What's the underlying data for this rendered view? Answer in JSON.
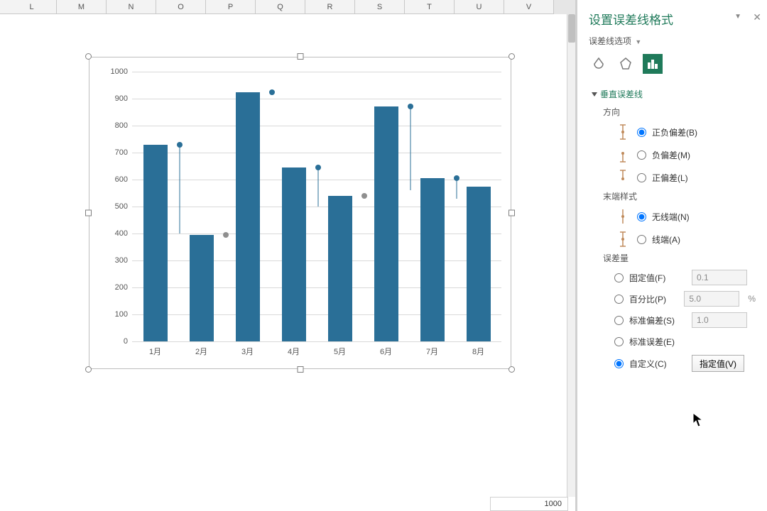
{
  "columns": [
    "L",
    "M",
    "N",
    "O",
    "P",
    "Q",
    "R",
    "S",
    "T",
    "U",
    "V"
  ],
  "pane": {
    "title": "设置误差线格式",
    "options_label": "误差线选项",
    "section_title": "垂直误差线",
    "direction_label": "方向",
    "dir_both": "正负偏差(B)",
    "dir_minus": "负偏差(M)",
    "dir_plus": "正偏差(L)",
    "endstyle_label": "末端样式",
    "end_none": "无线端(N)",
    "end_cap": "线端(A)",
    "error_amount_label": "误差量",
    "ea_fixed": "固定值(F)",
    "ea_percent": "百分比(P)",
    "ea_stddev": "标准偏差(S)",
    "ea_stderr": "标准误差(E)",
    "ea_custom": "自定义(C)",
    "ea_fixed_val": "0.1",
    "ea_percent_val": "5.0",
    "ea_stddev_val": "1.0",
    "specify_btn": "指定值(V)"
  },
  "bottom_cell_value": "1000",
  "chart_data": {
    "type": "bar",
    "categories": [
      "1月",
      "2月",
      "3月",
      "4月",
      "5月",
      "6月",
      "7月",
      "8月"
    ],
    "values": [
      730,
      395,
      925,
      645,
      540,
      870,
      605,
      575
    ],
    "error_plus": [
      0,
      0,
      0,
      0,
      0,
      0,
      0,
      0
    ],
    "error_markers": [
      {
        "x": 1,
        "y": 730,
        "color": "blue"
      },
      {
        "x": 2,
        "y": 395,
        "color": "grey"
      },
      {
        "x": 3,
        "y": 925,
        "color": "blue"
      },
      {
        "x": 4,
        "y": 645,
        "color": "blue"
      },
      {
        "x": 5,
        "y": 540,
        "color": "grey"
      },
      {
        "x": 6,
        "y": 870,
        "color": "blue"
      },
      {
        "x": 7,
        "y": 605,
        "color": "blue"
      }
    ],
    "error_lines": [
      {
        "x": 1,
        "y0": 400,
        "y1": 730
      },
      {
        "x": 4,
        "y0": 500,
        "y1": 645
      },
      {
        "x": 6,
        "y0": 560,
        "y1": 870
      },
      {
        "x": 7,
        "y0": 530,
        "y1": 605
      }
    ],
    "title": "",
    "xlabel": "",
    "ylabel": "",
    "ylim": [
      0,
      1000
    ],
    "y_ticks": [
      0,
      100,
      200,
      300,
      400,
      500,
      600,
      700,
      800,
      900,
      1000
    ]
  }
}
